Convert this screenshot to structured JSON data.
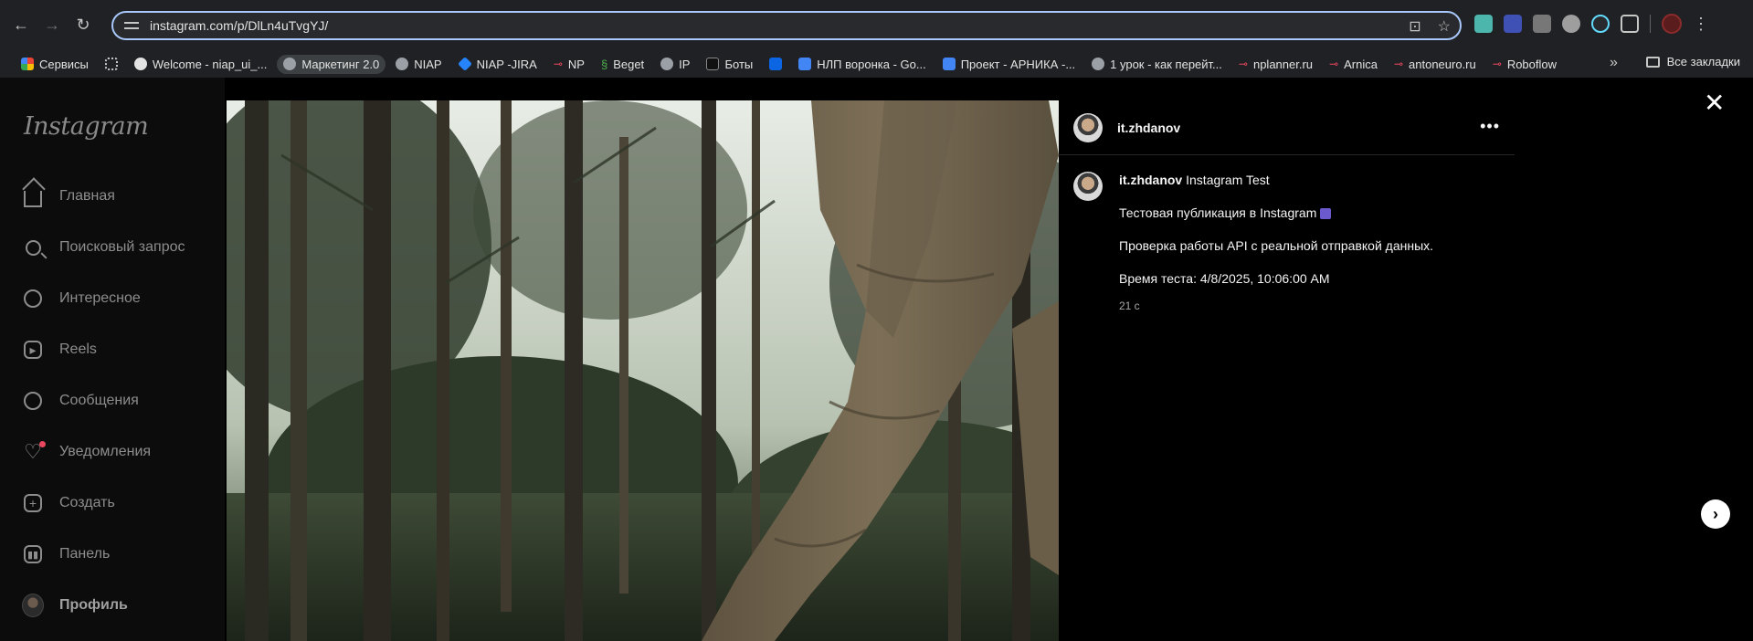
{
  "browser": {
    "url": "instagram.com/p/DlLn4uTvgYJ/",
    "bookmarks": [
      {
        "label": "Сервисы",
        "icon": "apps-icon"
      },
      {
        "label": "",
        "icon": "grid-icon"
      },
      {
        "label": "Welcome - niap_ui_...",
        "icon": "github-icon"
      },
      {
        "label": "Маркетинг 2.0",
        "icon": "globe-icon"
      },
      {
        "label": "NIAP",
        "icon": "globe-icon"
      },
      {
        "label": "NIAP -JIRA",
        "icon": "jira-icon"
      },
      {
        "label": "NP",
        "icon": "link-icon"
      },
      {
        "label": "Beget",
        "icon": "beget-icon"
      },
      {
        "label": "IP",
        "icon": "globe-icon"
      },
      {
        "label": "Боты",
        "icon": "bots-icon"
      },
      {
        "label": "",
        "icon": "trello-icon"
      },
      {
        "label": "НЛП воронка - Go...",
        "icon": "doc-icon"
      },
      {
        "label": "Проект - АРНИКА -...",
        "icon": "doc-icon"
      },
      {
        "label": "1 урок - как перейт...",
        "icon": "globe-icon"
      },
      {
        "label": "nplanner.ru",
        "icon": "link-icon"
      },
      {
        "label": "Arnica",
        "icon": "link-icon"
      },
      {
        "label": "antoneuro.ru",
        "icon": "link-icon"
      },
      {
        "label": "Roboflow",
        "icon": "link-icon"
      }
    ],
    "all_bookmarks_label": "Все закладки"
  },
  "instagram": {
    "logo": "Instagram",
    "nav": [
      {
        "label": "Главная",
        "icon": "home-icon"
      },
      {
        "label": "Поисковый запрос",
        "icon": "search-icon"
      },
      {
        "label": "Интересное",
        "icon": "explore-icon"
      },
      {
        "label": "Reels",
        "icon": "reels-icon"
      },
      {
        "label": "Сообщения",
        "icon": "messenger-icon"
      },
      {
        "label": "Уведомления",
        "icon": "heart-icon"
      },
      {
        "label": "Создать",
        "icon": "create-icon"
      },
      {
        "label": "Панель",
        "icon": "dashboard-icon"
      },
      {
        "label": "Профиль",
        "icon": "profile-avatar"
      }
    ],
    "post": {
      "username": "it.zhdanov",
      "caption_title": "Instagram Test",
      "line1": "Тестовая публикация в Instagram",
      "line2": "Проверка работы API с реальной отправкой данных.",
      "line3": "Время теста: 4/8/2025, 10:06:00 AM",
      "time_ago": "21 с"
    }
  }
}
